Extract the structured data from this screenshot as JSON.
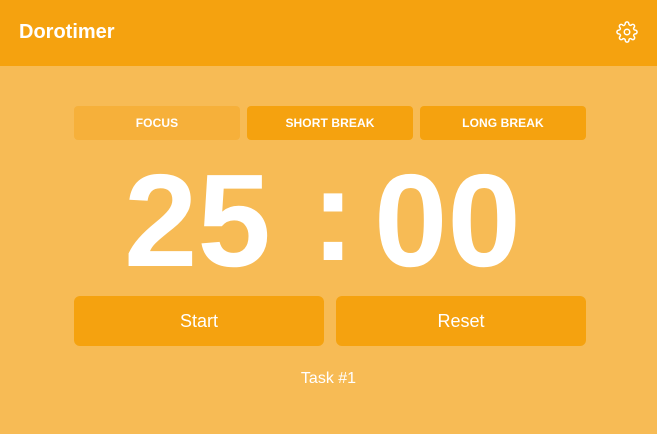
{
  "app": {
    "title": "Dorotimer",
    "settings_icon": "gear-icon"
  },
  "tabs": [
    {
      "label": "FOCUS",
      "active": true
    },
    {
      "label": "SHORT BREAK",
      "active": false
    },
    {
      "label": "LONG BREAK",
      "active": false
    }
  ],
  "timer": {
    "minutes": "25",
    "separator": ":",
    "seconds": "00"
  },
  "actions": {
    "start_label": "Start",
    "reset_label": "Reset"
  },
  "task": {
    "label": "Task #1"
  },
  "colors": {
    "background": "#f7bb55",
    "header": "#f5a20f",
    "button": "#f5a20f",
    "active_tab": "#f6b03a",
    "text": "#ffffff"
  }
}
